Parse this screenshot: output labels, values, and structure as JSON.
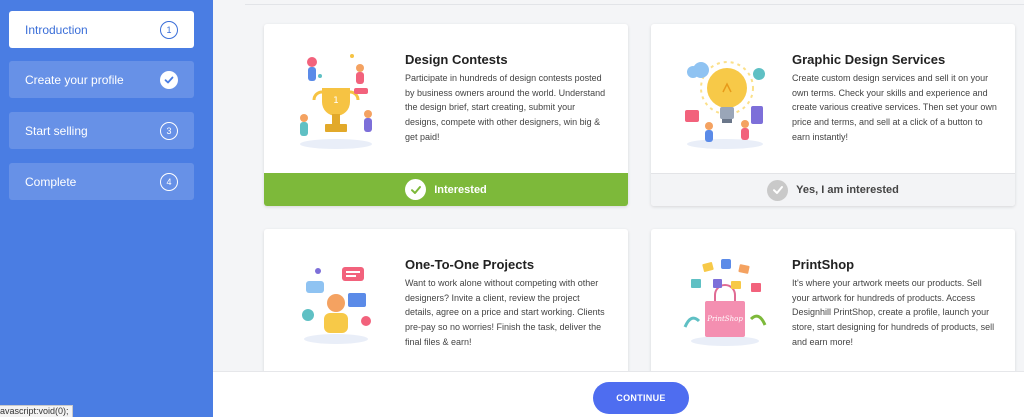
{
  "sidebar": {
    "steps": [
      {
        "label": "Introduction",
        "number": "1",
        "state": "active"
      },
      {
        "label": "Create your profile",
        "number": "",
        "state": "done"
      },
      {
        "label": "Start selling",
        "number": "3",
        "state": "pending"
      },
      {
        "label": "Complete",
        "number": "4",
        "state": "pending"
      }
    ]
  },
  "status_bar": {
    "text": "avascript:void(0);"
  },
  "cards": [
    {
      "title": "Design Contests",
      "description": "Participate in hundreds of design contests posted by business owners around the world. Understand the design brief, start creating, submit your designs, compete with other designers, win big & get paid!",
      "button": "Interested",
      "selected": true,
      "illustration": "trophy-illustration"
    },
    {
      "title": "Graphic Design Services",
      "description": "Create custom design services and sell it on your own terms. Check your skills and experience and create various creative services. Then set your own price and terms, and sell at a click of a button to earn instantly!",
      "button": "Yes, I am interested",
      "selected": false,
      "illustration": "lightbulb-illustration"
    },
    {
      "title": "One-To-One Projects",
      "description": "Want to work alone without competing with other designers? Invite a client, review the project details, agree on a price and start working. Clients pre-pay so no worries! Finish the task, deliver the final files & earn!",
      "illustration": "chat-illustration"
    },
    {
      "title": "PrintShop",
      "description": "It's where your artwork meets our products. Sell your artwork for hundreds of products. Access Designhill PrintShop, create a profile, launch your store, start designing for hundreds of products, sell and earn more!",
      "illustration": "printshop-bag-illustration",
      "bag_label": "PrintShop"
    }
  ],
  "footer": {
    "continue_label": "CONTINUE"
  },
  "colors": {
    "sidebar": "#4a7de3",
    "accent_green": "#7db93a",
    "button_blue": "#4e6df0"
  }
}
